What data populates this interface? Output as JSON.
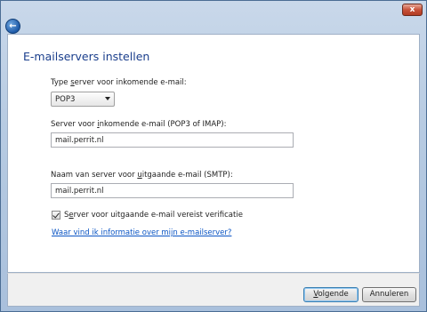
{
  "window": {
    "close_label": "x",
    "back_icon": "back-arrow-icon"
  },
  "main": {
    "title": "E-mailservers instellen",
    "incoming_type": {
      "label_pre": "Type ",
      "label_access": "s",
      "label_post": "erver voor inkomende e-mail:",
      "selected": "POP3"
    },
    "incoming_server": {
      "label_pre": "Server voor ",
      "label_access": "i",
      "label_post": "nkomende e-mail (POP3 of IMAP):",
      "value": "mail.perrit.nl"
    },
    "outgoing_server": {
      "label_pre": "Naam van server voor ",
      "label_access": "u",
      "label_post": "itgaande e-mail (SMTP):",
      "value": "mail.perrit.nl"
    },
    "auth_checkbox": {
      "label_pre": "S",
      "label_access": "e",
      "label_post": "rver voor uitgaande e-mail vereist verificatie",
      "checked": true
    },
    "help_link": "Waar vind ik informatie over mijn e-mailserver?"
  },
  "footer": {
    "next_pre": "",
    "next_access": "V",
    "next_post": "olgende",
    "cancel_label": "Annuleren"
  }
}
